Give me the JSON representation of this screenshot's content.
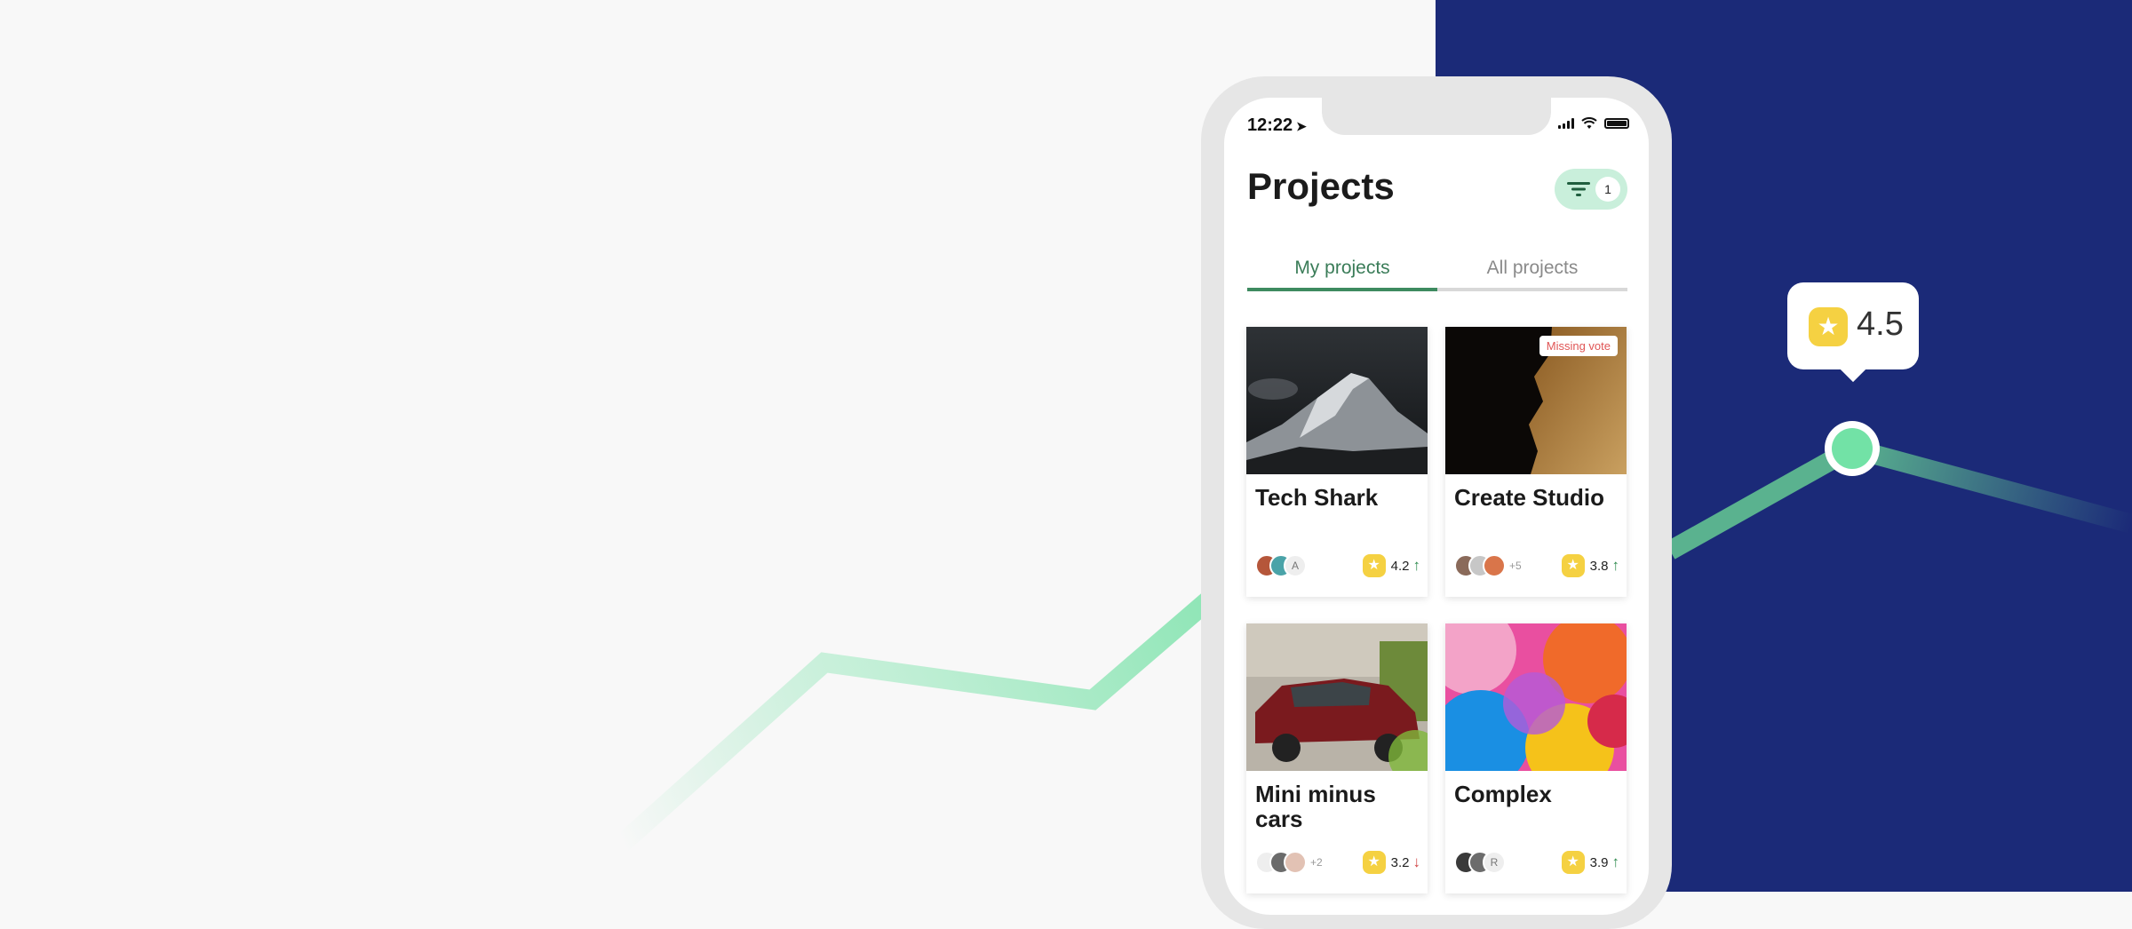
{
  "colors": {
    "accent": "#3e8a60",
    "navy": "#1b2a78",
    "star": "#f5d142",
    "dot": "#72e2a6",
    "down": "#d04545",
    "up": "#2e8a4e"
  },
  "status": {
    "time": "12:22",
    "location_arrow": "➤"
  },
  "header": {
    "title": "Projects",
    "filter_count": "1",
    "filter_icon": "filter-icon"
  },
  "tabs": [
    {
      "label": "My projects",
      "active": true
    },
    {
      "label": "All projects",
      "active": false
    }
  ],
  "projects": [
    {
      "name": "Tech Shark",
      "rating": "4.2",
      "trend": "↑",
      "avatar_initial": "A",
      "more": "",
      "badge": ""
    },
    {
      "name": "Create Studio",
      "rating": "3.8",
      "trend": "↑",
      "avatar_initial": "",
      "more": "+5",
      "badge": "Missing vote"
    },
    {
      "name": "Mini minus cars",
      "rating": "3.2",
      "trend": "↓",
      "avatar_initial": "",
      "more": "+2",
      "badge": ""
    },
    {
      "name": "Complex",
      "rating": "3.9",
      "trend": "↑",
      "avatar_initial": "R",
      "more": "",
      "badge": ""
    }
  ],
  "tooltip": {
    "rating": "4.5",
    "star": "★"
  }
}
